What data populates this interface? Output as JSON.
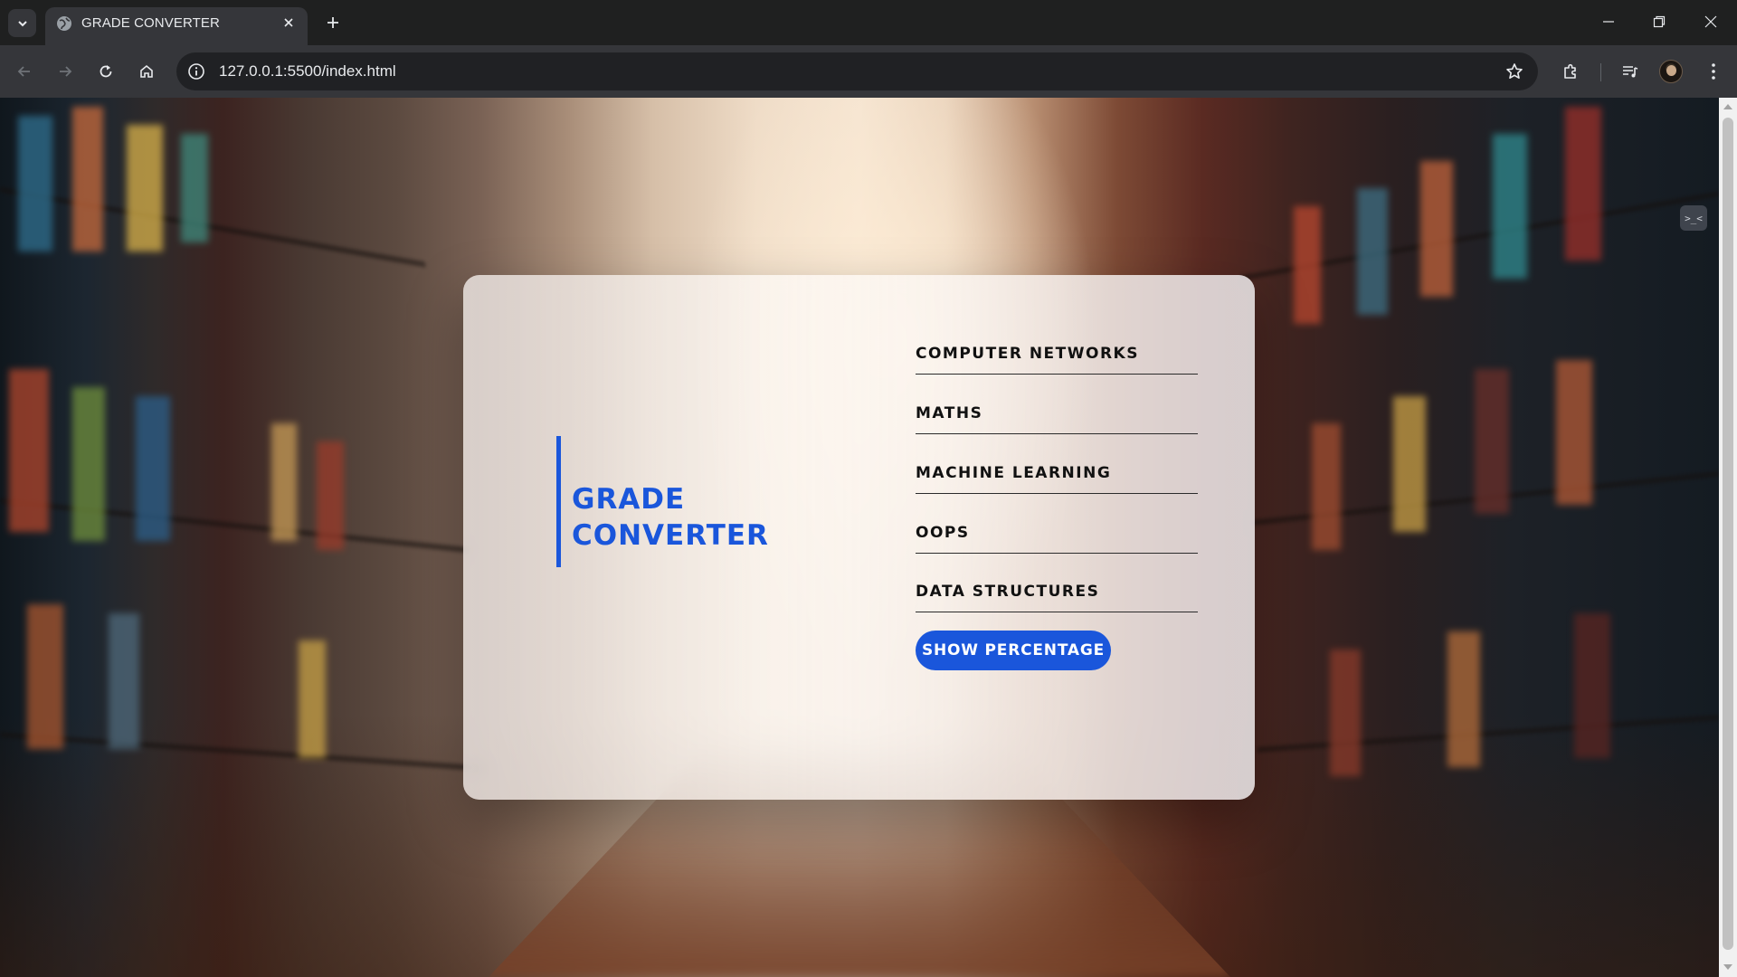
{
  "browser": {
    "tab_title": "GRADE CONVERTER",
    "url": "127.0.0.1:5500/index.html"
  },
  "icons": {
    "tab_list": "chevron-down-icon",
    "favicon": "globe-icon",
    "close_tab": "close-icon",
    "new_tab": "plus-icon",
    "back": "arrow-left-icon",
    "forward": "arrow-right-icon",
    "reload": "reload-icon",
    "home": "home-icon",
    "site_info": "info-icon",
    "bookmark": "star-icon",
    "extensions": "puzzle-icon",
    "media": "media-controls-icon",
    "menu": "kebab-menu-icon"
  },
  "page": {
    "title": "GRADE\nCONVERTER",
    "subjects": [
      "COMPUTER NETWORKS",
      "MATHS",
      "MACHINE LEARNING",
      "OOPS",
      "DATA STRUCTURES"
    ],
    "button_label": "SHOW PERCENTAGE"
  },
  "extension_widget_label": ">_<",
  "colors": {
    "accent": "#1a56db",
    "chrome_dark": "#1f2020",
    "chrome_toolbar": "#35363a"
  }
}
